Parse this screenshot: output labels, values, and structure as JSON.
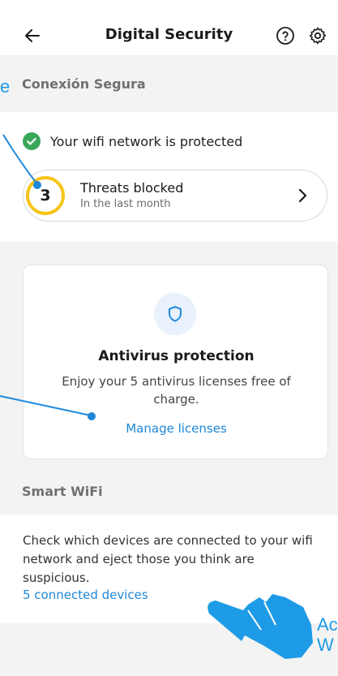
{
  "header": {
    "title": "Digital Security",
    "back_icon": "arrow-left-icon",
    "help_icon": "help-circle-icon",
    "settings_icon": "gear-icon"
  },
  "secure_connection": {
    "section_title": "Conexión Segura",
    "status_text": "Your wifi network is protected",
    "status_color": "#3aa85a",
    "threats": {
      "count": "3",
      "title": "Threats blocked",
      "subtitle": "In the last month",
      "ring_color": "#f5c518"
    }
  },
  "antivirus": {
    "title": "Antivirus protection",
    "description": "Enjoy your 5 antivirus licenses free of charge.",
    "link": "Manage licenses",
    "icon": "shield-icon"
  },
  "smart_wifi": {
    "section_title": "Smart WiFi",
    "description": "Check which devices are connected to your wifi network and eject those you think are suspicious.",
    "link": "5 connected devices"
  },
  "callouts": {
    "top_left": "e",
    "bottom_right_line1": "Ac",
    "bottom_right_line2": "W"
  },
  "colors": {
    "accent": "#1e88d9",
    "section_bg": "#f3f3f3",
    "callout": "#1e9be6"
  }
}
